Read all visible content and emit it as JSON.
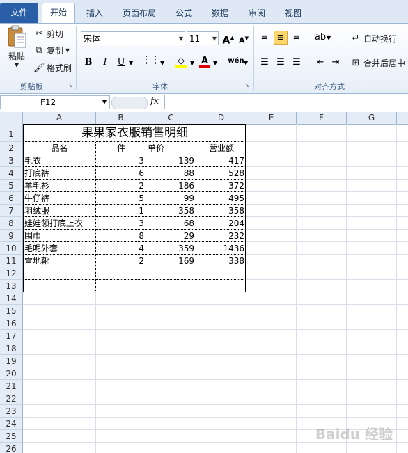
{
  "tabs": [
    "文件",
    "开始",
    "插入",
    "页面布局",
    "公式",
    "数据",
    "审阅",
    "视图"
  ],
  "active_tab": "开始",
  "ribbon": {
    "clipboard": {
      "paste": "粘贴",
      "cut": "剪切",
      "copy": "复制",
      "format_painter": "格式刷",
      "label": "剪贴板"
    },
    "font": {
      "name": "宋体",
      "size": "11",
      "label": "字体",
      "bold": "B",
      "italic": "I",
      "underline": "U",
      "grow": "A",
      "shrink": "A",
      "font_color": "A",
      "wen": "wén"
    },
    "alignment": {
      "wrap": "自动换行",
      "merge": "合并后居中",
      "label": "对齐方式"
    }
  },
  "formula_bar": {
    "name_box": "F12",
    "fx": "fx",
    "value": ""
  },
  "columns": [
    "A",
    "B",
    "C",
    "D",
    "E",
    "F",
    "G"
  ],
  "rows": [
    "1",
    "2",
    "3",
    "4",
    "5",
    "6",
    "7",
    "8",
    "9",
    "10",
    "11",
    "12",
    "13",
    "14",
    "15",
    "16",
    "17",
    "18",
    "19",
    "20",
    "21",
    "22",
    "23",
    "24",
    "25",
    "26"
  ],
  "sheet": {
    "title": "果果家衣服销售明细",
    "headers": [
      "品名",
      "件",
      "单价",
      "营业额"
    ],
    "data": [
      [
        "毛衣",
        "3",
        "139",
        "417"
      ],
      [
        "打底裤",
        "6",
        "88",
        "528"
      ],
      [
        "羊毛衫",
        "2",
        "186",
        "372"
      ],
      [
        "牛仔裤",
        "5",
        "99",
        "495"
      ],
      [
        "羽绒服",
        "1",
        "358",
        "358"
      ],
      [
        "娃娃领打底上衣",
        "3",
        "68",
        "204"
      ],
      [
        "围巾",
        "8",
        "29",
        "232"
      ],
      [
        "毛呢外套",
        "4",
        "359",
        "1436"
      ],
      [
        "雪地靴",
        "2",
        "169",
        "338"
      ]
    ]
  },
  "watermark": "Baidu 经验"
}
